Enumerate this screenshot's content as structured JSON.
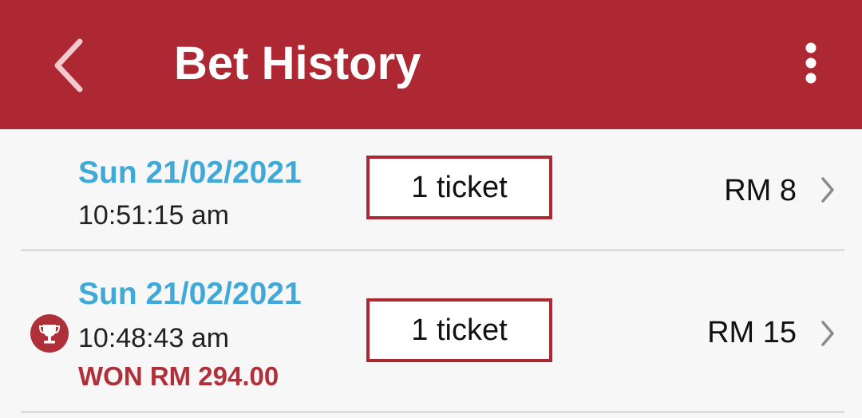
{
  "header": {
    "title": "Bet History",
    "back_icon": "chevron-left-icon",
    "menu_icon": "more-vertical-icon"
  },
  "colors": {
    "appbar": "#ad2832",
    "date_text": "#3fa9d8",
    "won_text": "#b0303a"
  },
  "bets": [
    {
      "date": "Sun 21/02/2021",
      "time": "10:51:15 am",
      "tickets": "1 ticket",
      "amount": "RM 8"
    },
    {
      "date": "Sun 21/02/2021",
      "time": "10:48:43 am",
      "won": "WON RM 294.00",
      "tickets": "1 ticket",
      "amount": "RM 15",
      "winner_icon": "trophy-icon"
    }
  ]
}
